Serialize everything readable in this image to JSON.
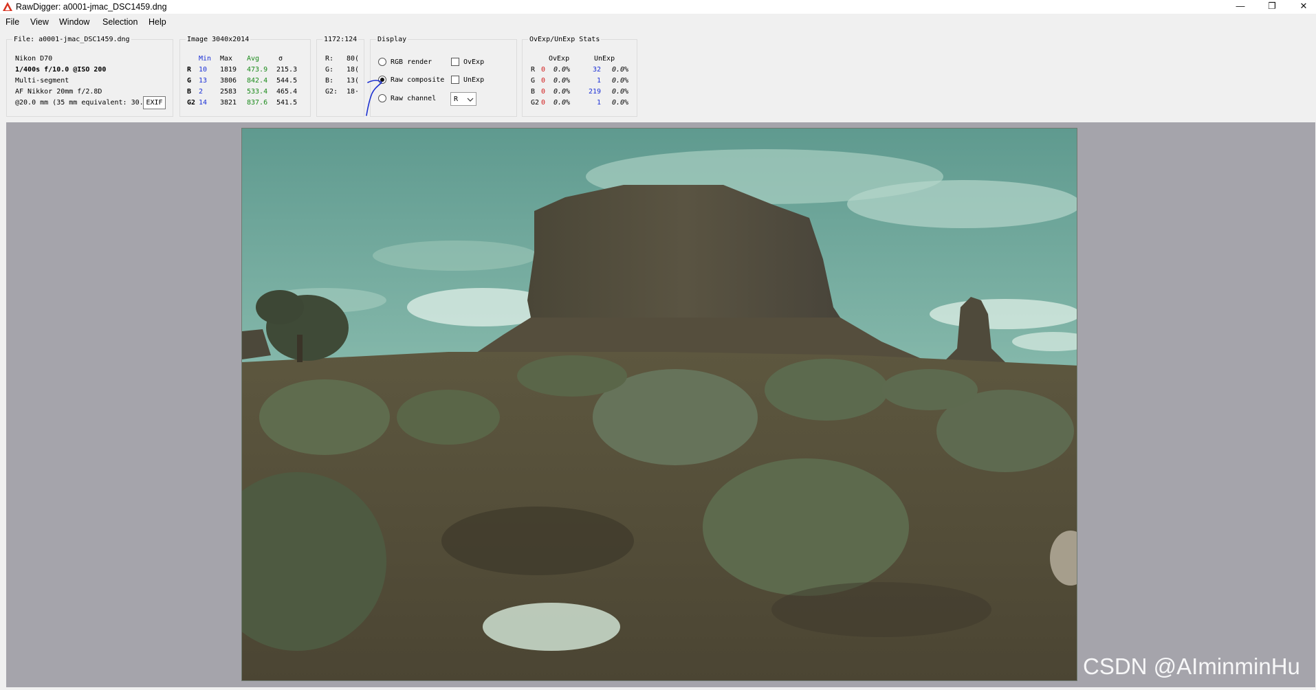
{
  "window": {
    "title": "RawDigger: a0001-jmac_DSC1459.dng",
    "minimize": "—",
    "restore": "❐",
    "close": "✕"
  },
  "menu": [
    "File",
    "View",
    "Window",
    "Selection",
    "Help"
  ],
  "file_info": {
    "legend": "File: a0001-jmac_DSC1459.dng",
    "camera": "Nikon D70",
    "exposure": "1/400s f/10.0 @ISO 200",
    "metering": "Multi-segment",
    "lens": "AF Nikkor 20mm f/2.8D",
    "focal": "@20.0 mm (35 mm equivalent: 30.",
    "exif_button": "EXIF"
  },
  "image_stats": {
    "legend": "Image 3040x2014",
    "headers": {
      "min": "Min",
      "max": "Max",
      "avg": "Avg",
      "sigma": "σ"
    },
    "rows": [
      {
        "ch": "R",
        "min": "10",
        "max": "1819",
        "avg": "473.9",
        "sigma": "215.3"
      },
      {
        "ch": "G",
        "min": "13",
        "max": "3806",
        "avg": "842.4",
        "sigma": "544.5"
      },
      {
        "ch": "B",
        "min": "2",
        "max": "2583",
        "avg": "533.4",
        "sigma": "465.4"
      },
      {
        "ch": "G2",
        "min": "14",
        "max": "3821",
        "avg": "837.6",
        "sigma": "541.5"
      }
    ]
  },
  "sample": {
    "legend": "1172:124",
    "rows": [
      {
        "label": "R:",
        "value": "80("
      },
      {
        "label": "G:",
        "value": "18("
      },
      {
        "label": "B:",
        "value": "13("
      },
      {
        "label": "G2:",
        "value": "18·"
      }
    ]
  },
  "display": {
    "legend": "Display",
    "rgb_render": "RGB render",
    "raw_composite": "Raw composite",
    "raw_channel": "Raw channel",
    "ovexp": "OvExp",
    "unexp": "UnExp",
    "channel_value": "R"
  },
  "ovexp_stats": {
    "legend": "OvExp/UnExp Stats",
    "headers": {
      "ov": "OvExp",
      "un": "UnExp"
    },
    "rows": [
      {
        "ch": "R",
        "ov": "0",
        "ov_pct": "0.0%",
        "un": "32",
        "un_pct": "0.0%"
      },
      {
        "ch": "G",
        "ov": "0",
        "ov_pct": "0.0%",
        "un": "1",
        "un_pct": "0.0%"
      },
      {
        "ch": "B",
        "ov": "0",
        "ov_pct": "0.0%",
        "un": "219",
        "un_pct": "0.0%"
      },
      {
        "ch": "G2",
        "ov": "0",
        "ov_pct": "0.0%",
        "un": "1",
        "un_pct": "0.0%"
      }
    ]
  },
  "watermark": "CSDN @AIminminHu",
  "colors": {
    "sky": "#7fb3a4",
    "rock": "#4e4a3a",
    "ground": "#56503a",
    "brush": "#5e6b4c",
    "panel": "#a5a4ab"
  }
}
